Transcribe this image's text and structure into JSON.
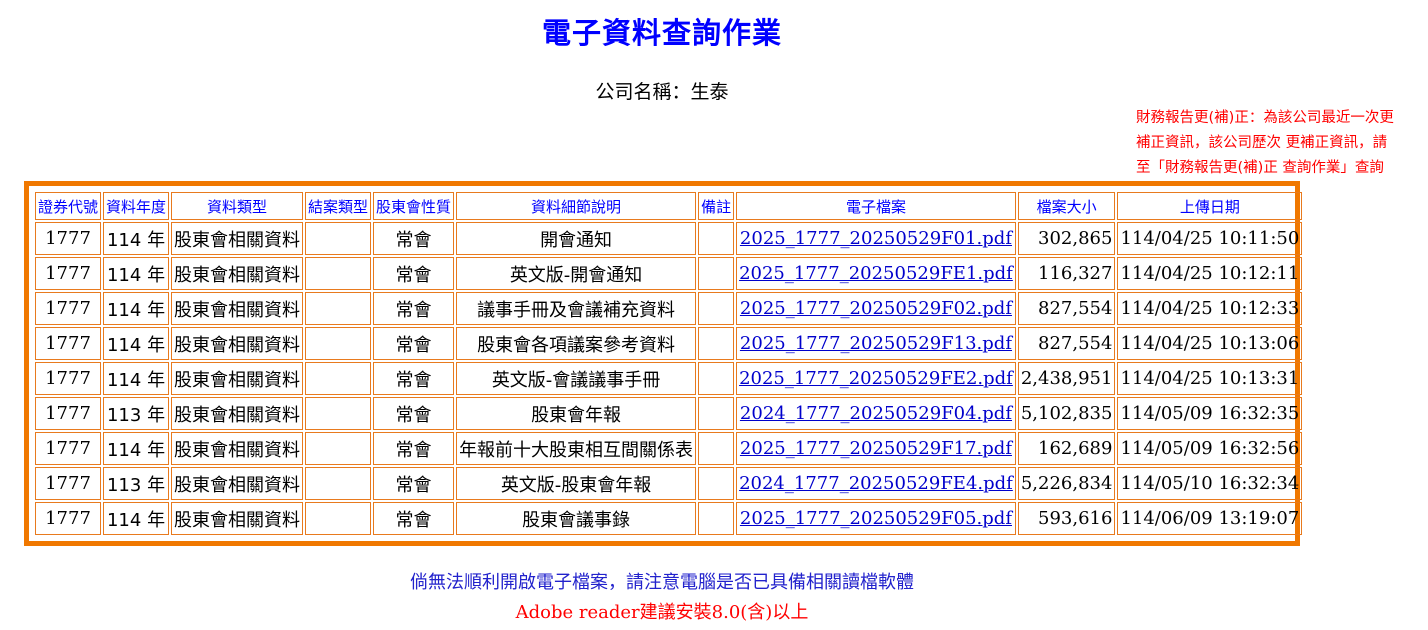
{
  "page": {
    "title": "電子資料查詢作業",
    "company_line": "公司名稱：生泰"
  },
  "notice": {
    "line1": "財務報告更(補)正：為該公司最近一次更",
    "line2": "補正資訊，該公司歷次 更補正資訊，請",
    "line3": "至「財務報告更(補)正 查詢作業」查詢"
  },
  "table": {
    "headers": [
      "證券代號",
      "資料年度",
      "資料類型",
      "結案類型",
      "股東會性質",
      "資料細節說明",
      "備註",
      "電子檔案",
      "檔案大小",
      "上傳日期"
    ],
    "rows": [
      {
        "code": "1777",
        "year": "114 年",
        "type": "股東會相關資料",
        "case": "",
        "nature": "常會",
        "detail": "開會通知",
        "note": "",
        "file": "2025_1777_20250529F01.pdf",
        "size": "302,865",
        "date": "114/04/25 10:11:50"
      },
      {
        "code": "1777",
        "year": "114 年",
        "type": "股東會相關資料",
        "case": "",
        "nature": "常會",
        "detail": "英文版-開會通知",
        "note": "",
        "file": "2025_1777_20250529FE1.pdf",
        "size": "116,327",
        "date": "114/04/25 10:12:11"
      },
      {
        "code": "1777",
        "year": "114 年",
        "type": "股東會相關資料",
        "case": "",
        "nature": "常會",
        "detail": "議事手冊及會議補充資料",
        "note": "",
        "file": "2025_1777_20250529F02.pdf",
        "size": "827,554",
        "date": "114/04/25 10:12:33"
      },
      {
        "code": "1777",
        "year": "114 年",
        "type": "股東會相關資料",
        "case": "",
        "nature": "常會",
        "detail": "股東會各項議案參考資料",
        "note": "",
        "file": "2025_1777_20250529F13.pdf",
        "size": "827,554",
        "date": "114/04/25 10:13:06"
      },
      {
        "code": "1777",
        "year": "114 年",
        "type": "股東會相關資料",
        "case": "",
        "nature": "常會",
        "detail": "英文版-會議議事手冊",
        "note": "",
        "file": "2025_1777_20250529FE2.pdf",
        "size": "2,438,951",
        "date": "114/04/25 10:13:31"
      },
      {
        "code": "1777",
        "year": "113 年",
        "type": "股東會相關資料",
        "case": "",
        "nature": "常會",
        "detail": "股東會年報",
        "note": "",
        "file": "2024_1777_20250529F04.pdf",
        "size": "5,102,835",
        "date": "114/05/09 16:32:35"
      },
      {
        "code": "1777",
        "year": "114 年",
        "type": "股東會相關資料",
        "case": "",
        "nature": "常會",
        "detail": "年報前十大股東相互間關係表",
        "note": "",
        "file": "2025_1777_20250529F17.pdf",
        "size": "162,689",
        "date": "114/05/09 16:32:56"
      },
      {
        "code": "1777",
        "year": "113 年",
        "type": "股東會相關資料",
        "case": "",
        "nature": "常會",
        "detail": "英文版-股東會年報",
        "note": "",
        "file": "2024_1777_20250529FE4.pdf",
        "size": "5,226,834",
        "date": "114/05/10 16:32:34"
      },
      {
        "code": "1777",
        "year": "114 年",
        "type": "股東會相關資料",
        "case": "",
        "nature": "常會",
        "detail": "股東會議事錄",
        "note": "",
        "file": "2025_1777_20250529F05.pdf",
        "size": "593,616",
        "date": "114/06/09 13:19:07"
      }
    ]
  },
  "footer": {
    "line1": "倘無法順利開啟電子檔案，請注意電腦是否已具備相關讀檔軟體",
    "line2": "Adobe reader建議安裝8.0(含)以上"
  },
  "colors": {
    "title": "#0000ff",
    "notice": "#ff0000",
    "frame": "#f07800",
    "link": "#0000cc"
  }
}
